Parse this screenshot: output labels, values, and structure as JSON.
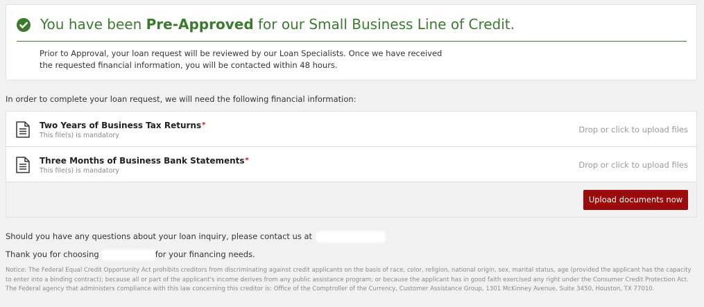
{
  "approval": {
    "headline_prefix": "You have been ",
    "headline_bold": "Pre-Approved",
    "headline_suffix": " for our Small Business Line of Credit.",
    "body": "Prior to Approval, your loan request will be reviewed by our Loan Specialists. Once we have received the requested financial information, you will be contacted within 48 hours.",
    "accent_color": "#3b7a2f",
    "icon": "check-circle-icon"
  },
  "intro": "In order to complete your loan request, we will need the following financial information:",
  "documents": [
    {
      "title": "Two Years of Business Tax Returns",
      "required_mark": "*",
      "subtitle": "This file(s) is mandatory",
      "drop_text": "Drop or click to upload files",
      "icon": "document-icon"
    },
    {
      "title": "Three Months of Business Bank Statements",
      "required_mark": "*",
      "subtitle": "This file(s) is mandatory",
      "drop_text": "Drop or click to upload files",
      "icon": "document-icon"
    }
  ],
  "upload_button": {
    "label": "Upload documents now",
    "color": "#9b0b0b"
  },
  "contact_line": "Should you have any questions about your loan inquiry, please contact us at",
  "thanks": {
    "prefix": "Thank you for choosing",
    "suffix": "for your financing needs."
  },
  "notice": "Notice: The Federal Equal Credit Opportunity Act prohibits creditors from discriminating against credit applicants on the basis of race, color, religion, national origin, sex, marital status, age (provided the applicant has the capacity to enter into a binding contract); because all or part of the applicant's income derives from any public assistance program; or because the applicant has in good faith exercised any right under the Consumer Credit Protection Act. The Federal agency that administers compliance with this law concerning this creditor is: Office of the Comptroller of the Currency, Customer Assistance Group, 1301 McKinney Avenue, Suite 3450, Houston, TX 77010."
}
